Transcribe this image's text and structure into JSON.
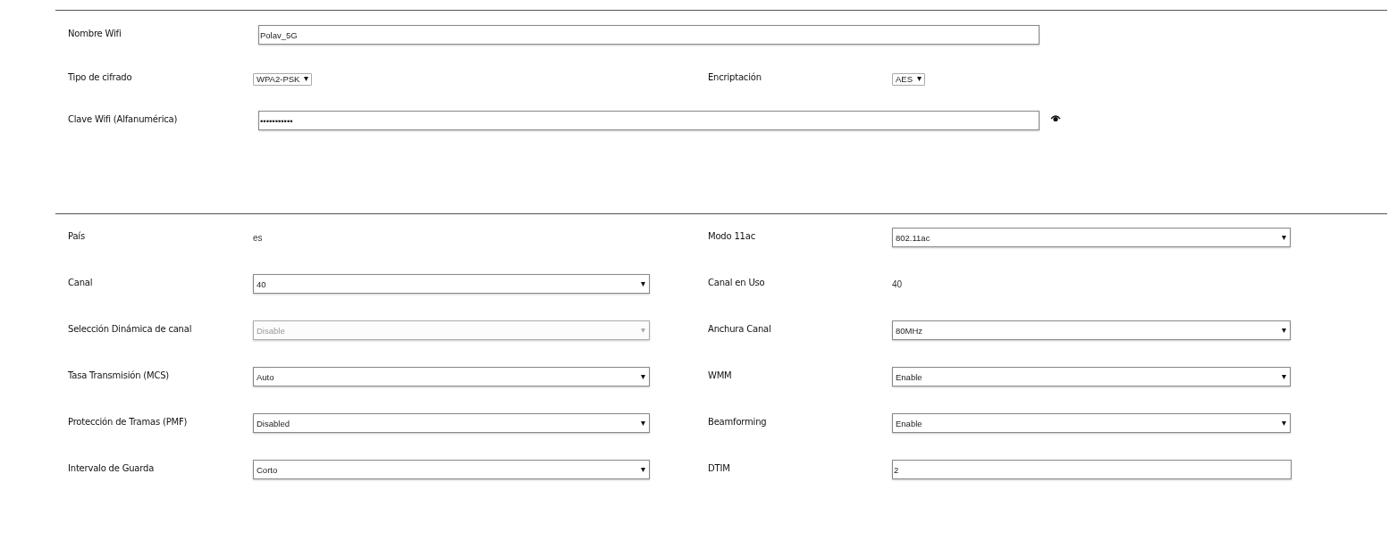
{
  "security": {
    "ssid": {
      "label": "Nombre Wifi",
      "value": "Polav_5G"
    },
    "cipher_type": {
      "label": "Tipo de cifrado",
      "value": "WPA2-PSK"
    },
    "encryption": {
      "label": "Encriptación",
      "value": "AES"
    },
    "password": {
      "label": "Clave Wifi (Alfanumérica)",
      "value": "•••••••••••"
    }
  },
  "advanced": {
    "left": [
      {
        "label": "País",
        "kind": "text",
        "value": "es"
      },
      {
        "label": "Canal",
        "kind": "select",
        "value": "40",
        "disabled": false
      },
      {
        "label": "Selección Dinámica de canal",
        "kind": "select",
        "value": "Disable",
        "disabled": true
      },
      {
        "label": "Tasa Transmisión (MCS)",
        "kind": "select",
        "value": "Auto",
        "disabled": false
      },
      {
        "label": "Protección de Tramas (PMF)",
        "kind": "select",
        "value": "Disabled",
        "disabled": false
      },
      {
        "label": "Intervalo de Guarda",
        "kind": "select",
        "value": "Corto",
        "disabled": false
      }
    ],
    "right": [
      {
        "label": "Modo 11ac",
        "kind": "select",
        "value": "802.11ac",
        "disabled": false
      },
      {
        "label": "Canal en Uso",
        "kind": "text",
        "value": "40"
      },
      {
        "label": "Anchura Canal",
        "kind": "select",
        "value": "80MHz",
        "disabled": false
      },
      {
        "label": "WMM",
        "kind": "select",
        "value": "Enable",
        "disabled": false
      },
      {
        "label": "Beamforming",
        "kind": "select",
        "value": "Enable",
        "disabled": false
      },
      {
        "label": "DTIM",
        "kind": "input",
        "value": "2"
      }
    ]
  }
}
